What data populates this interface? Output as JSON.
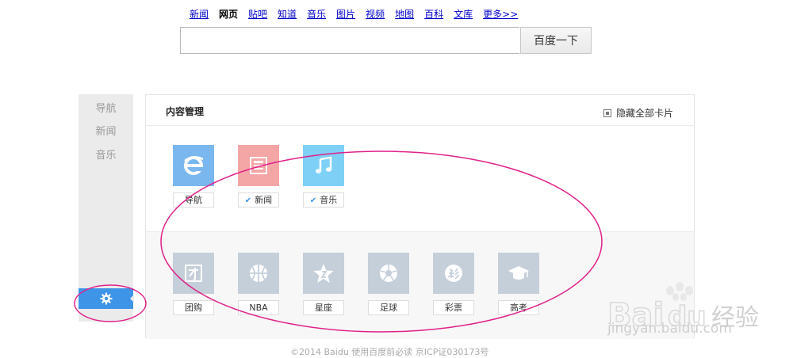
{
  "top_nav": {
    "links": [
      "新闻",
      "网页",
      "贴吧",
      "知道",
      "音乐",
      "图片",
      "视频",
      "地图",
      "百科",
      "文库",
      "更多>>"
    ],
    "active": "网页"
  },
  "search": {
    "value": "",
    "button_label": "百度一下"
  },
  "sidenav": {
    "items": [
      "导航",
      "新闻",
      "音乐"
    ],
    "settings_icon": "gear-icon"
  },
  "panel": {
    "title": "内容管理",
    "hide_all_label": "隐藏全部卡片",
    "active_cards": [
      {
        "label": "导航",
        "icon": "ie-icon",
        "checked": false
      },
      {
        "label": "新闻",
        "icon": "newspaper-icon",
        "checked": true
      },
      {
        "label": "音乐",
        "icon": "music-note-icon",
        "checked": true
      }
    ],
    "inactive_cards": [
      {
        "label": "团购",
        "icon": "group-buy-icon"
      },
      {
        "label": "NBA",
        "icon": "basketball-icon"
      },
      {
        "label": "星座",
        "icon": "star-icon"
      },
      {
        "label": "足球",
        "icon": "soccer-icon"
      },
      {
        "label": "彩票",
        "icon": "lottery-icon"
      },
      {
        "label": "高考",
        "icon": "graduation-cap-icon"
      }
    ]
  },
  "footer": {
    "text": "©2014 Baidu 使用百度前必读 京ICP证030173号"
  },
  "watermark": {
    "logo_text": "Bai经验",
    "url_text": "jingyan.baidu.com"
  },
  "colors": {
    "accent": "#3e95e8",
    "annotation": "#e0218a",
    "link": "#0000cc"
  }
}
